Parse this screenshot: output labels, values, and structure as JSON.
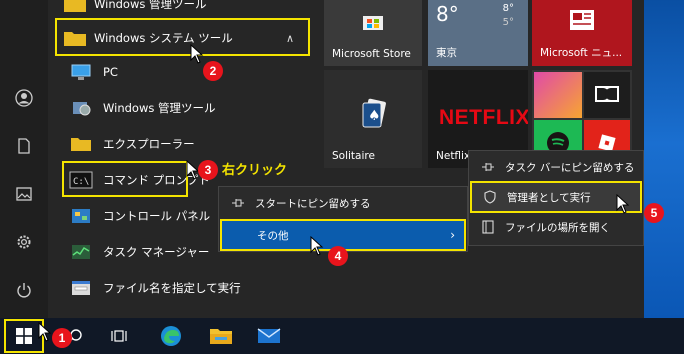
{
  "app_list": {
    "top_folder_label": "Windows 管理ツール",
    "expanded_folder_label": "Windows システム ツール",
    "items": [
      {
        "label": "PC",
        "icon": "pc-icon"
      },
      {
        "label": "Windows 管理ツール",
        "icon": "admin-tools-icon"
      },
      {
        "label": "エクスプローラー",
        "icon": "folder-icon"
      },
      {
        "label": "コマンド プロンプト",
        "icon": "cmd-icon"
      },
      {
        "label": "コントロール パネル",
        "icon": "control-panel-icon"
      },
      {
        "label": "タスク マネージャー",
        "icon": "task-manager-icon"
      },
      {
        "label": "ファイル名を指定して実行",
        "icon": "run-icon"
      }
    ]
  },
  "tiles": {
    "microsoft_store": "Microsoft Store",
    "weather_temp": "8°",
    "weather_high": "8°",
    "weather_low": "5°",
    "weather_city": "東京",
    "news": "Microsoft ニュ...",
    "solitaire": "Solitaire",
    "netflix": "Netflix",
    "netflix_logo": "NETFLIX"
  },
  "context_menu_1": {
    "items": [
      "スタートにピン留めする",
      "その他"
    ]
  },
  "context_menu_2": {
    "items": [
      "タスク バーにピン留めする",
      "管理者として実行",
      "ファイルの場所を開く"
    ]
  },
  "annotations": {
    "right_click": "右クリック",
    "steps": [
      "1",
      "2",
      "3",
      "4",
      "5"
    ]
  },
  "colors": {
    "highlight": "#f4e400",
    "badge": "#e8141c",
    "accent": "#0b5cad"
  }
}
